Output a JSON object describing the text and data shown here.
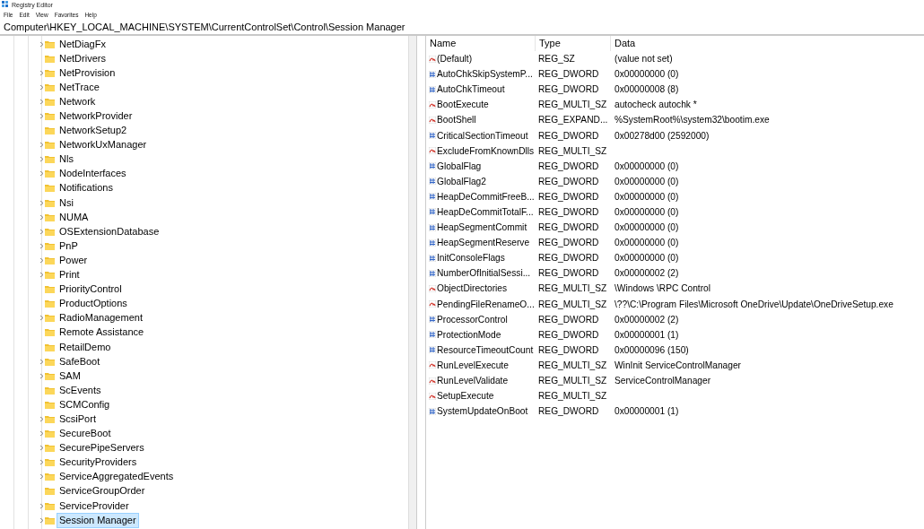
{
  "window": {
    "title": "Registry Editor"
  },
  "menu": [
    "File",
    "Edit",
    "View",
    "Favorites",
    "Help"
  ],
  "address": "Computer\\HKEY_LOCAL_MACHINE\\SYSTEM\\CurrentControlSet\\Control\\Session Manager",
  "tree": [
    {
      "label": "NetDiagFx",
      "expandable": true,
      "selected": false
    },
    {
      "label": "NetDrivers",
      "expandable": false,
      "selected": false
    },
    {
      "label": "NetProvision",
      "expandable": true,
      "selected": false
    },
    {
      "label": "NetTrace",
      "expandable": true,
      "selected": false
    },
    {
      "label": "Network",
      "expandable": true,
      "selected": false
    },
    {
      "label": "NetworkProvider",
      "expandable": true,
      "selected": false
    },
    {
      "label": "NetworkSetup2",
      "expandable": false,
      "selected": false
    },
    {
      "label": "NetworkUxManager",
      "expandable": true,
      "selected": false
    },
    {
      "label": "Nls",
      "expandable": true,
      "selected": false
    },
    {
      "label": "NodeInterfaces",
      "expandable": true,
      "selected": false
    },
    {
      "label": "Notifications",
      "expandable": false,
      "selected": false
    },
    {
      "label": "Nsi",
      "expandable": true,
      "selected": false
    },
    {
      "label": "NUMA",
      "expandable": true,
      "selected": false
    },
    {
      "label": "OSExtensionDatabase",
      "expandable": true,
      "selected": false
    },
    {
      "label": "PnP",
      "expandable": true,
      "selected": false
    },
    {
      "label": "Power",
      "expandable": true,
      "selected": false
    },
    {
      "label": "Print",
      "expandable": true,
      "selected": false
    },
    {
      "label": "PriorityControl",
      "expandable": false,
      "selected": false
    },
    {
      "label": "ProductOptions",
      "expandable": false,
      "selected": false
    },
    {
      "label": "RadioManagement",
      "expandable": true,
      "selected": false
    },
    {
      "label": "Remote Assistance",
      "expandable": false,
      "selected": false
    },
    {
      "label": "RetailDemo",
      "expandable": false,
      "selected": false
    },
    {
      "label": "SafeBoot",
      "expandable": true,
      "selected": false
    },
    {
      "label": "SAM",
      "expandable": true,
      "selected": false
    },
    {
      "label": "ScEvents",
      "expandable": false,
      "selected": false
    },
    {
      "label": "SCMConfig",
      "expandable": false,
      "selected": false
    },
    {
      "label": "ScsiPort",
      "expandable": true,
      "selected": false
    },
    {
      "label": "SecureBoot",
      "expandable": true,
      "selected": false
    },
    {
      "label": "SecurePipeServers",
      "expandable": true,
      "selected": false
    },
    {
      "label": "SecurityProviders",
      "expandable": true,
      "selected": false
    },
    {
      "label": "ServiceAggregatedEvents",
      "expandable": true,
      "selected": false
    },
    {
      "label": "ServiceGroupOrder",
      "expandable": false,
      "selected": false
    },
    {
      "label": "ServiceProvider",
      "expandable": true,
      "selected": false
    },
    {
      "label": "Session Manager",
      "expandable": true,
      "selected": true
    }
  ],
  "table": {
    "columns": [
      "Name",
      "Type",
      "Data"
    ],
    "rows": [
      {
        "kind": "string",
        "name": "(Default)",
        "type": "REG_SZ",
        "data": "(value not set)"
      },
      {
        "kind": "binary",
        "name": "AutoChkSkipSystemP...",
        "type": "REG_DWORD",
        "data": "0x00000000 (0)"
      },
      {
        "kind": "binary",
        "name": "AutoChkTimeout",
        "type": "REG_DWORD",
        "data": "0x00000008 (8)"
      },
      {
        "kind": "string",
        "name": "BootExecute",
        "type": "REG_MULTI_SZ",
        "data": "autocheck autochk *"
      },
      {
        "kind": "string",
        "name": "BootShell",
        "type": "REG_EXPAND...",
        "data": "%SystemRoot%\\system32\\bootim.exe"
      },
      {
        "kind": "binary",
        "name": "CriticalSectionTimeout",
        "type": "REG_DWORD",
        "data": "0x00278d00 (2592000)"
      },
      {
        "kind": "string",
        "name": "ExcludeFromKnownDlls",
        "type": "REG_MULTI_SZ"
      },
      {
        "kind": "binary",
        "name": "GlobalFlag",
        "type": "REG_DWORD",
        "data": "0x00000000 (0)"
      },
      {
        "kind": "binary",
        "name": "GlobalFlag2",
        "type": "REG_DWORD",
        "data": "0x00000000 (0)"
      },
      {
        "kind": "binary",
        "name": "HeapDeCommitFreeB...",
        "type": "REG_DWORD",
        "data": "0x00000000 (0)"
      },
      {
        "kind": "binary",
        "name": "HeapDeCommitTotalF...",
        "type": "REG_DWORD",
        "data": "0x00000000 (0)"
      },
      {
        "kind": "binary",
        "name": "HeapSegmentCommit",
        "type": "REG_DWORD",
        "data": "0x00000000 (0)"
      },
      {
        "kind": "binary",
        "name": "HeapSegmentReserve",
        "type": "REG_DWORD",
        "data": "0x00000000 (0)"
      },
      {
        "kind": "binary",
        "name": "InitConsoleFlags",
        "type": "REG_DWORD",
        "data": "0x00000000 (0)"
      },
      {
        "kind": "binary",
        "name": "NumberOfInitialSessi...",
        "type": "REG_DWORD",
        "data": "0x00000002 (2)"
      },
      {
        "kind": "string",
        "name": "ObjectDirectories",
        "type": "REG_MULTI_SZ",
        "data": "\\Windows \\RPC Control"
      },
      {
        "kind": "string",
        "name": "PendingFileRenameO...",
        "type": "REG_MULTI_SZ",
        "data": "\\??\\C:\\Program Files\\Microsoft OneDrive\\Update\\OneDriveSetup.exe"
      },
      {
        "kind": "binary",
        "name": "ProcessorControl",
        "type": "REG_DWORD",
        "data": "0x00000002 (2)"
      },
      {
        "kind": "binary",
        "name": "ProtectionMode",
        "type": "REG_DWORD",
        "data": "0x00000001 (1)"
      },
      {
        "kind": "binary",
        "name": "ResourceTimeoutCount",
        "type": "REG_DWORD",
        "data": "0x00000096 (150)"
      },
      {
        "kind": "string",
        "name": "RunLevelExecute",
        "type": "REG_MULTI_SZ",
        "data": "WinInit ServiceControlManager"
      },
      {
        "kind": "string",
        "name": "RunLevelValidate",
        "type": "REG_MULTI_SZ",
        "data": "ServiceControlManager"
      },
      {
        "kind": "string",
        "name": "SetupExecute",
        "type": "REG_MULTI_SZ"
      },
      {
        "kind": "binary",
        "name": "SystemUpdateOnBoot",
        "type": "REG_DWORD",
        "data": "0x00000001 (1)"
      }
    ]
  }
}
